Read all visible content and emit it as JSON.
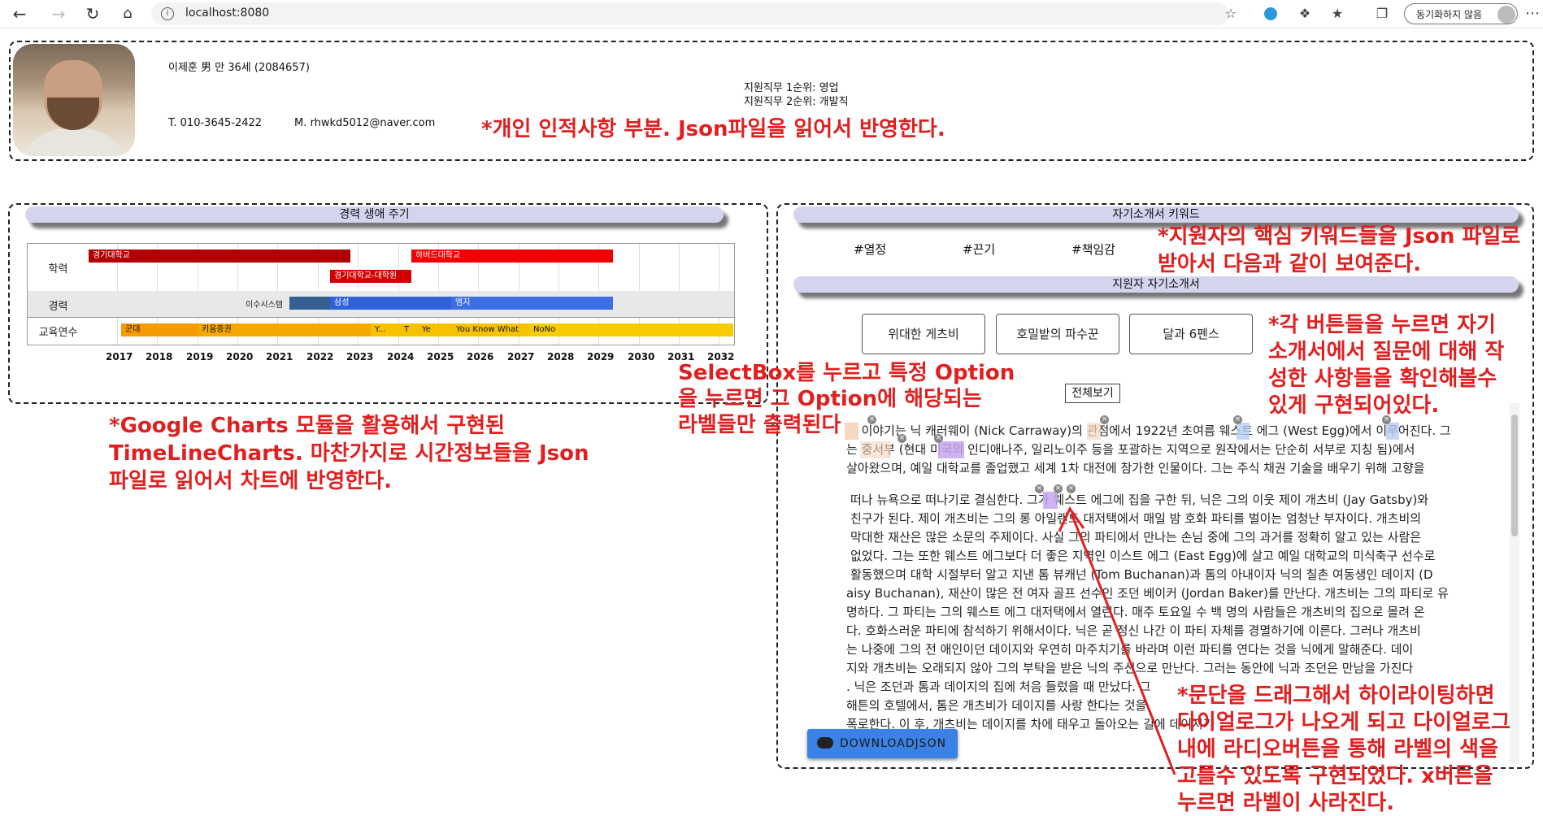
{
  "browser": {
    "url": "localhost:8080",
    "sync_label": "동기화하지 않음"
  },
  "profile": {
    "name_line": "이제훈 男 만 36세 (2084657)",
    "phone": "T. 010-3645-2422",
    "email": "M. rhwkd5012@naver.com",
    "job1": "지원직무 1순위: 영업",
    "job2": "지원직무 2순위: 개발직",
    "annotation": "*개인 인적사항 부분. Json파일을 읽어서 반영한다."
  },
  "career": {
    "title": "경력 생애 주기",
    "row_labels": [
      "학력",
      "경력",
      "교육연수"
    ],
    "years": [
      "2017",
      "2018",
      "2019",
      "2020",
      "2021",
      "2022",
      "2023",
      "2024",
      "2025",
      "2026",
      "2027",
      "2028",
      "2029",
      "2030",
      "2031",
      "2032"
    ],
    "bars": {
      "edu1": "경기대학교",
      "edu2": "경기대학교-대학원",
      "edu3": "하버드대학교",
      "job0": "이수시스템",
      "job1": "삼성",
      "job2": "엠지",
      "tr1": "군대",
      "tr2": "키움증권",
      "tr3": "Y...",
      "tr4": "T",
      "tr5": "Ye",
      "tr6": "You Know What",
      "tr7": "NoNo"
    },
    "colors": {
      "edu": "#c00000",
      "edu_alt": "#f00000",
      "job_dark": "#365f91",
      "job": "#2f62d8",
      "training": "#f6c200",
      "training_alt": "#f59a00"
    },
    "annotation": [
      "*Google Charts 모듈을 활용해서 구현된",
      "TimeLineCharts. 마찬가지로 시간정보들을 Json",
      "파일로 읽어서 차트에 반영한다."
    ]
  },
  "keywords": {
    "title": "자기소개서 키워드",
    "items": [
      "#열정",
      "#끈기",
      "#책임감"
    ],
    "annotation": [
      "*지원자의 핵심 키워드들을 Json 파일로",
      "받아서 다음과 같이 보여준다."
    ]
  },
  "essay": {
    "title": "지원자 자기소개서",
    "buttons": [
      "위대한 게츠비",
      "호밀밭의 파수꾼",
      "달과 6펜스"
    ],
    "select_label": "전체보기",
    "button_annotation": [
      "*각 버튼들을 누르면 자기",
      "소개서에서 질문에 대해 작",
      "성한 사항들을 확인해볼수",
      "있게 구현되어있다."
    ],
    "select_annotation": [
      "SelectBox를 누르고 특정 Option",
      "을 누르면 그 Option에 해당되는",
      "라벨들만 출력된다"
    ],
    "lines": [
      "이 이야기는 닉 캐러웨이 (Nick Carraway)의 관점에서 1922년 초여름 웨스트 에그 (West Egg)에서 이루어진다. 그",
      "는 중서부 (현대 미국의 인디애나주, 일리노이주 등을 포괄하는 지역으로 원작에서는 단순히 서부로 지칭 됨)에서",
      "살아왔으며, 예일 대학교를 졸업했고 세계 1차 대전에 참가한 인물이다. 그는 주식 채권 기술을 배우기 위해 고향을",
      "떠나 뉴욕으로 떠나기로 결심한다. 그가 웨스트 에그에 집을 구한 뒤, 닉은 그의 이웃 제이 개츠비 (Jay Gatsby)와",
      "친구가 된다. 제이 개츠비는 그의 롱 아일랜드 대저택에서 매일 밤 호화 파티를 벌이는 엄청난 부자이다. 개츠비의",
      "막대한 재산은 많은 소문의 주제이다. 사실 그의 파티에서 만나는 손님 중에 그의 과거를 정확히 알고 있는 사람은",
      "없었다. 그는 또한 웨스트 에그보다 더 좋은 지역인 이스트 에그 (East Egg)에 살고 예일 대학교의 미식축구 선수로",
      "활동했으며 대학 시절부터 알고 지낸 톰 뷰캐넌 (Tom Buchanan)과 톰의 아내이자 닉의 칠촌 여동생인 데이지 (D",
      "aisy Buchanan), 재산이 많은 전 여자 골프 선수인 조던 베이커 (Jordan Baker)를 만난다. 개츠비는 그의 파티로 유",
      "명하다. 그 파티는 그의 웨스트 에그 대저택에서 열린다. 매주 토요일 수 백 명의 사람들은 개츠비의 집으로 몰려 온",
      "다. 호화스러운 파티에 참석하기 위해서이다. 닉은 곧 정신 나간 이 파티 자체를 경멸하기에 이른다. 그러나 개츠비",
      "는 나중에 그의 전 애인이던 데이지와 우연히 마주치기를 바라며 이런 파티를 연다는 것을 닉에게 말해준다. 데이",
      "지와 개츠비는 오래되지 않아 그의 부탁을 받은 닉의 주선으로 만난다. 그러는 동안에 닉과 조던은 만남을 가진다",
      ". 닉은 조던과 톰과 데이지의 집에 처음 들렀을 때 만났다. 그",
      "해튼의 호텔에서, 톰은 개츠비가 데이지를 사랑 한다는 것을",
      "폭로한다. 이 후, 개츠비는 데이지를 차에 태우고 돌아오는 길에 데이지가"
    ],
    "drag_annotation": [
      "*문단을 드래그해서 하이라이팅하면",
      "다이얼로그가 나오게 되고 다이얼로그",
      "내에 라디오버튼을 통해 라벨의 색을",
      "고를수 있도록 구현되었다. x버튼을",
      "누르면 라벨이 사라진다."
    ],
    "download_label": "DOWNLOADJSON"
  },
  "icons": {
    "back": "back-arrow-icon",
    "forward": "forward-arrow-icon",
    "reload": "reload-icon",
    "home": "home-icon",
    "info": "info-icon",
    "cloud": "cloud-download-icon",
    "close": "close-x-icon"
  }
}
